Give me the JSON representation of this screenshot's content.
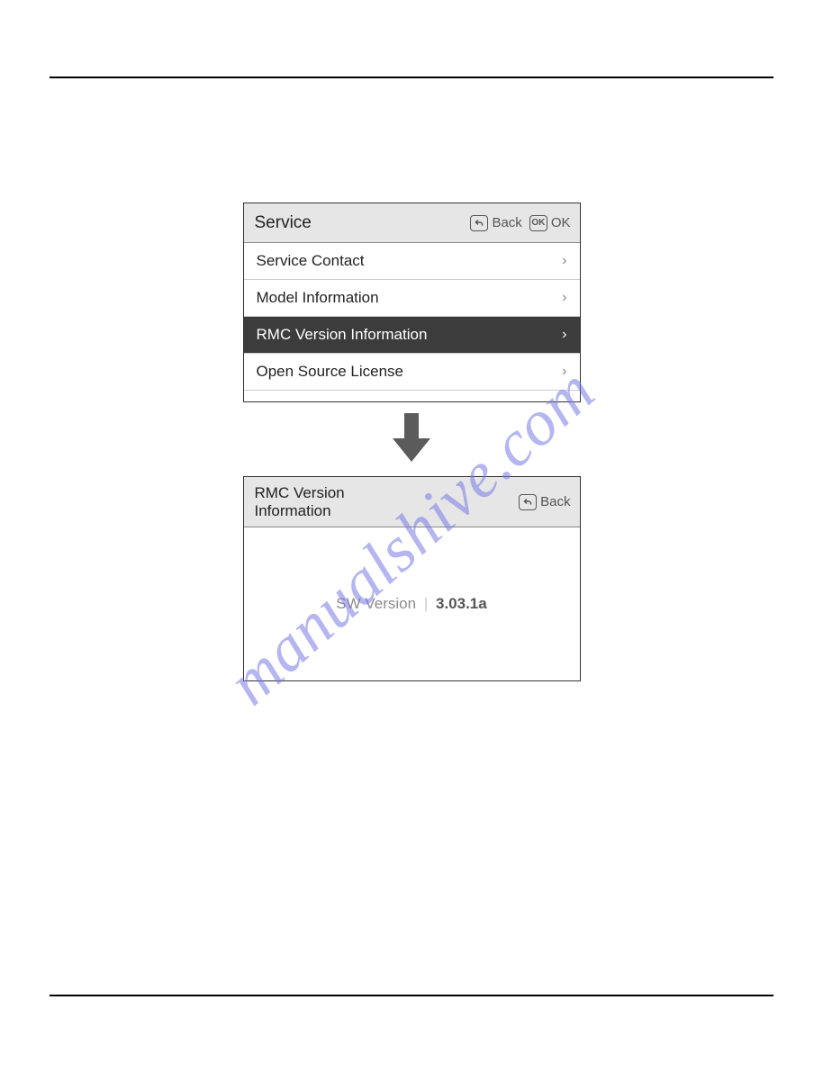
{
  "watermark": "manualshive.com",
  "servicePanel": {
    "title": "Service",
    "backLabel": "Back",
    "okLabel": "OK",
    "items": [
      {
        "label": "Service Contact",
        "selected": false
      },
      {
        "label": "Model Information",
        "selected": false
      },
      {
        "label": "RMC Version Information",
        "selected": true
      },
      {
        "label": "Open Source License",
        "selected": false
      }
    ]
  },
  "detailPanel": {
    "titleLine1": "RMC Version",
    "titleLine2": "Information",
    "backLabel": "Back",
    "swVersionLabel": "SW Version",
    "swVersionValue": "3.03.1a"
  }
}
